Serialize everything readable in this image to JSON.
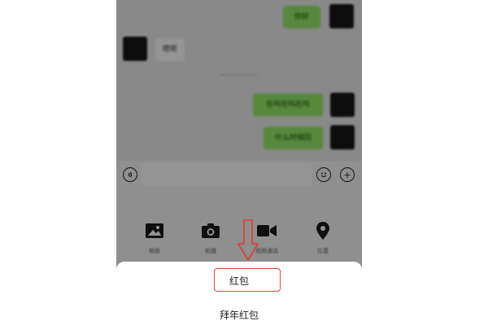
{
  "chat": {
    "messages": [
      {
        "side": "right",
        "text": "你好"
      },
      {
        "side": "left",
        "text": "嗯呢"
      },
      {
        "side": "right",
        "text": "在吗在吗在吗"
      },
      {
        "side": "right",
        "text": "什么时候回"
      }
    ],
    "timestamp": "——————"
  },
  "tools": [
    {
      "label": "相册",
      "icon": "image-icon"
    },
    {
      "label": "拍摄",
      "icon": "camera-icon"
    },
    {
      "label": "视频通话",
      "icon": "video-call-icon"
    },
    {
      "label": "位置",
      "icon": "location-icon"
    }
  ],
  "sheet": {
    "items": [
      "红包",
      "拜年红包"
    ]
  },
  "colors": {
    "bubble_green": "#95ec69",
    "highlight_red": "#e0463b"
  }
}
